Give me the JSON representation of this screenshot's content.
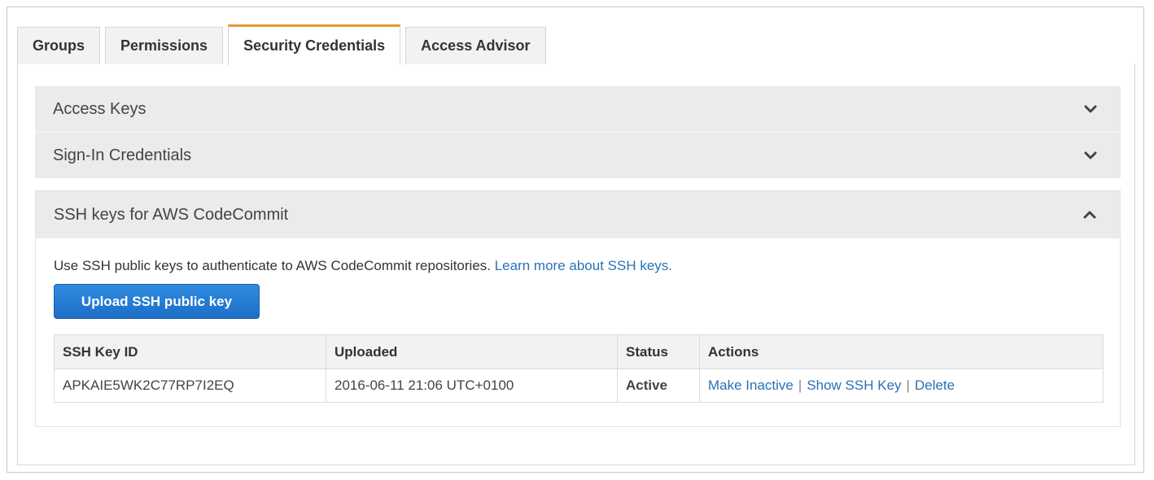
{
  "tabs": [
    {
      "label": "Groups"
    },
    {
      "label": "Permissions"
    },
    {
      "label": "Security Credentials"
    },
    {
      "label": "Access Advisor"
    }
  ],
  "accordion": {
    "access_keys": {
      "label": "Access Keys",
      "icon": "chevron-down-icon"
    },
    "signin_credentials": {
      "label": "Sign-In Credentials",
      "icon": "chevron-down-icon"
    },
    "ssh_keys": {
      "label": "SSH keys for AWS CodeCommit",
      "icon": "chevron-up-icon"
    }
  },
  "ssh": {
    "description": "Use SSH public keys to authenticate to AWS CodeCommit repositories. ",
    "learn_more": "Learn more about SSH keys.",
    "upload_label": "Upload SSH public key",
    "table": {
      "headers": [
        "SSH Key ID",
        "Uploaded",
        "Status",
        "Actions"
      ],
      "rows": [
        {
          "key_id": "APKAIE5WK2C77RP7I2EQ",
          "uploaded": "2016-06-11 21:06 UTC+0100",
          "status": "Active",
          "actions": [
            "Make Inactive",
            "Show SSH Key",
            "Delete"
          ]
        }
      ]
    }
  },
  "colors": {
    "accent_tab": "#e59a34",
    "button_blue": "#1c6ec6",
    "link_blue": "#2a72b5",
    "status_green": "#2a8a1e"
  }
}
